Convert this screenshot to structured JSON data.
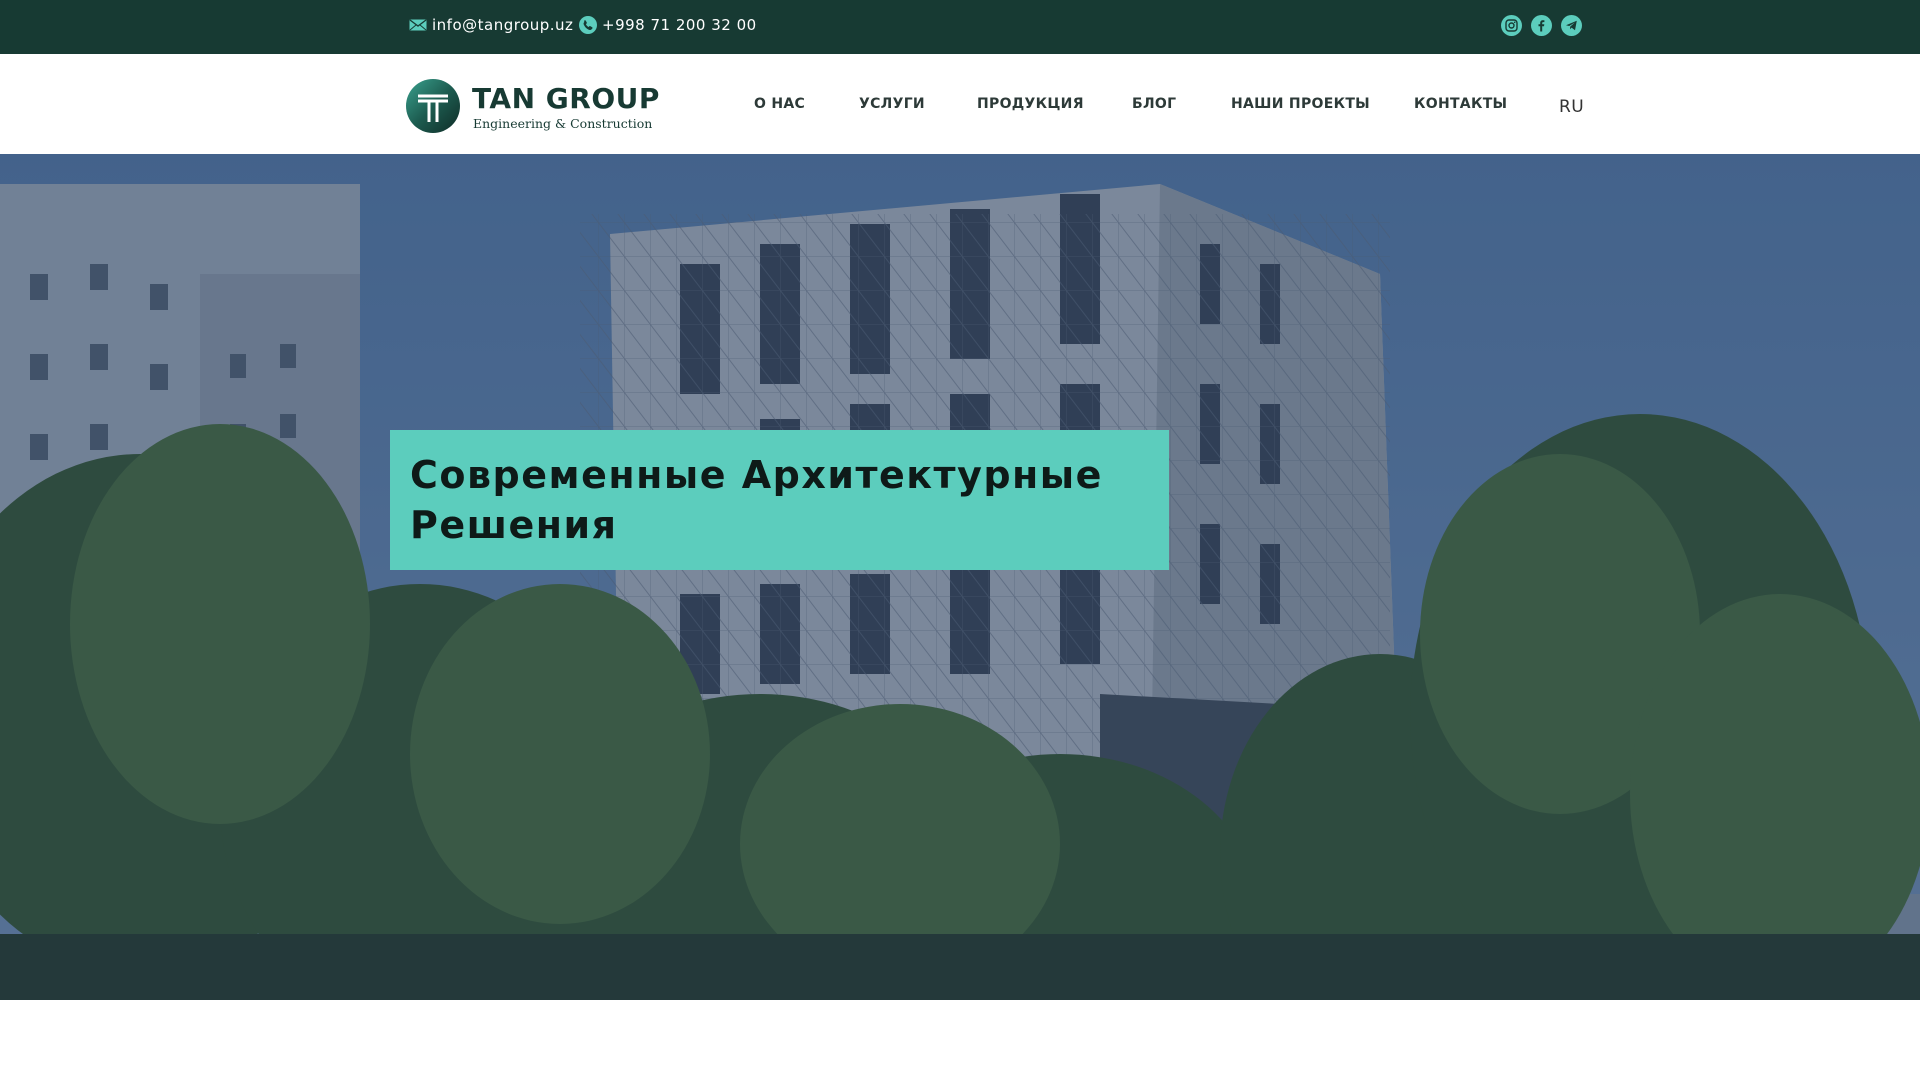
{
  "topbar": {
    "email": "info@tangroup.uz",
    "phone": "+998 71 200 32 00",
    "email_icon": "mail-icon",
    "phone_icon": "phone-icon",
    "socials": [
      {
        "name": "instagram",
        "icon": "instagram-icon"
      },
      {
        "name": "facebook",
        "icon": "facebook-icon"
      },
      {
        "name": "telegram",
        "icon": "telegram-icon"
      }
    ]
  },
  "header": {
    "logo": {
      "name": "TAN GROUP",
      "tagline": "Engineering & Construction"
    },
    "nav": [
      {
        "label": "О НАС"
      },
      {
        "label": "УСЛУГИ"
      },
      {
        "label": "ПРОДУКЦИЯ"
      },
      {
        "label": "БЛОГ"
      },
      {
        "label": "НАШИ ПРОЕКТЫ"
      },
      {
        "label": "КОНТАКТЫ"
      }
    ],
    "language": "RU"
  },
  "hero": {
    "title_line1": "Современные Архитектурные",
    "title_line2": "Решения"
  },
  "colors": {
    "topbar_bg": "#173a33",
    "accent": "#5ccdbd",
    "text_dark": "#0e1a18",
    "hero_tint": "#18345f"
  }
}
